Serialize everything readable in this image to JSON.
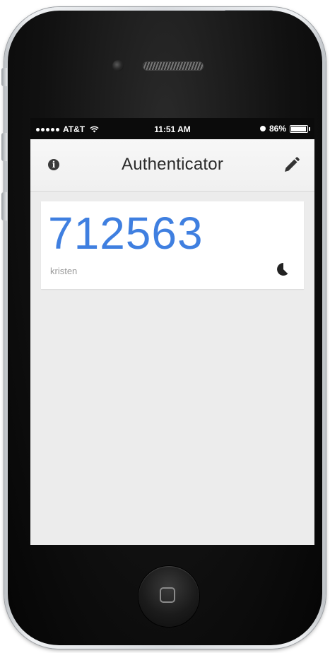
{
  "status_bar": {
    "carrier": "AT&T",
    "time": "11:51 AM",
    "battery_percent": "86%",
    "battery_level": 0.86,
    "icons": [
      "signal-dots-icon",
      "wifi-icon",
      "alarm-icon",
      "battery-icon"
    ]
  },
  "nav": {
    "title": "Authenticator",
    "left_icon": "info-icon",
    "right_icon": "pencil-edit-icon"
  },
  "accounts": [
    {
      "code": "712563",
      "name": "kristen",
      "timer_icon": "countdown-pie-icon"
    }
  ],
  "colors": {
    "code_blue": "#3f7fe0",
    "screen_background": "#ececec",
    "card_background": "#ffffff",
    "status_bar": "#0b0b0b"
  },
  "device": {
    "home_button_icon": "home-square-icon"
  }
}
